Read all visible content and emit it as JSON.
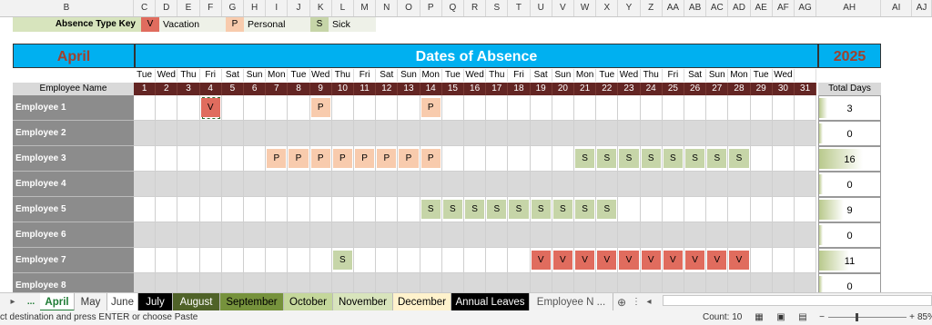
{
  "column_headers": [
    "B",
    "C",
    "D",
    "E",
    "F",
    "G",
    "H",
    "I",
    "J",
    "K",
    "L",
    "M",
    "N",
    "O",
    "P",
    "Q",
    "R",
    "S",
    "T",
    "U",
    "V",
    "W",
    "X",
    "Y",
    "Z",
    "AA",
    "AB",
    "AC",
    "AD",
    "AE",
    "AF",
    "AG",
    "AH",
    "AI",
    "AJ"
  ],
  "key": {
    "title": "Absence Type Key",
    "items": [
      {
        "code": "V",
        "label": "Vacation",
        "color": "#e06c5e"
      },
      {
        "code": "P",
        "label": "Personal",
        "color": "#f8cbad"
      },
      {
        "code": "S",
        "label": "Sick",
        "color": "#c6d5a8"
      }
    ]
  },
  "banner": {
    "month": "April",
    "title": "Dates of Absence",
    "year": "2025"
  },
  "weekdays": [
    "Tue",
    "Wed",
    "Thu",
    "Fri",
    "Sat",
    "Sun",
    "Mon",
    "Tue",
    "Wed",
    "Thu",
    "Fri",
    "Sat",
    "Sun",
    "Mon",
    "Tue",
    "Wed",
    "Thu",
    "Fri",
    "Sat",
    "Sun",
    "Mon",
    "Tue",
    "Wed",
    "Thu",
    "Fri",
    "Sat",
    "Sun",
    "Mon",
    "Tue",
    "Wed",
    ""
  ],
  "day_numbers": [
    "1",
    "2",
    "3",
    "4",
    "5",
    "6",
    "7",
    "8",
    "9",
    "10",
    "11",
    "12",
    "13",
    "14",
    "15",
    "16",
    "17",
    "18",
    "19",
    "20",
    "21",
    "22",
    "23",
    "24",
    "25",
    "26",
    "27",
    "28",
    "29",
    "30",
    "31"
  ],
  "employee_name_header": "Employee Name",
  "total_days_header": "Total Days",
  "employees": [
    {
      "name": "Employee 1",
      "total": "3",
      "marks": {
        "4": "V",
        "9": "P",
        "14": "P"
      }
    },
    {
      "name": "Employee 2",
      "total": "0",
      "marks": {}
    },
    {
      "name": "Employee 3",
      "total": "16",
      "marks": {
        "7": "P",
        "8": "P",
        "9": "P",
        "10": "P",
        "11": "P",
        "12": "P",
        "13": "P",
        "14": "P",
        "21": "S",
        "22": "S",
        "23": "S",
        "24": "S",
        "25": "S",
        "26": "S",
        "27": "S",
        "28": "S"
      }
    },
    {
      "name": "Employee 4",
      "total": "0",
      "marks": {}
    },
    {
      "name": "Employee 5",
      "total": "9",
      "marks": {
        "14": "S",
        "15": "S",
        "16": "S",
        "17": "S",
        "18": "S",
        "19": "S",
        "20": "S",
        "21": "S",
        "22": "S"
      }
    },
    {
      "name": "Employee 6",
      "total": "0",
      "marks": {}
    },
    {
      "name": "Employee 7",
      "total": "11",
      "marks": {
        "10": "S",
        "19": "V",
        "20": "V",
        "21": "V",
        "22": "V",
        "23": "V",
        "24": "V",
        "25": "V",
        "26": "V",
        "27": "V",
        "28": "V"
      }
    },
    {
      "name": "Employee 8",
      "total": "0",
      "marks": {}
    }
  ],
  "sheet_tabs": [
    {
      "label": "April",
      "bg": "#ffffff",
      "fg": "#1e7b34",
      "active": true
    },
    {
      "label": "May",
      "bg": "#f2f2f2",
      "fg": "#333333"
    },
    {
      "label": "June",
      "bg": "#ffffff",
      "fg": "#333333"
    },
    {
      "label": "July",
      "bg": "#000000",
      "fg": "#ffffff"
    },
    {
      "label": "August",
      "bg": "#4f6228",
      "fg": "#ffffff"
    },
    {
      "label": "September",
      "bg": "#76923c",
      "fg": "#000000"
    },
    {
      "label": "October",
      "bg": "#c4d79b",
      "fg": "#000000"
    },
    {
      "label": "November",
      "bg": "#d8e4bc",
      "fg": "#000000"
    },
    {
      "label": "December",
      "bg": "#fff2cc",
      "fg": "#000000"
    },
    {
      "label": "Annual Leaves",
      "bg": "#000000",
      "fg": "#ffffff"
    },
    {
      "label": "Employee N ...",
      "bg": "#f2f2f2",
      "fg": "#555555"
    }
  ],
  "status": {
    "message": "ct destination and press ENTER or choose Paste",
    "count": "Count: 10",
    "zoom": "85%"
  }
}
